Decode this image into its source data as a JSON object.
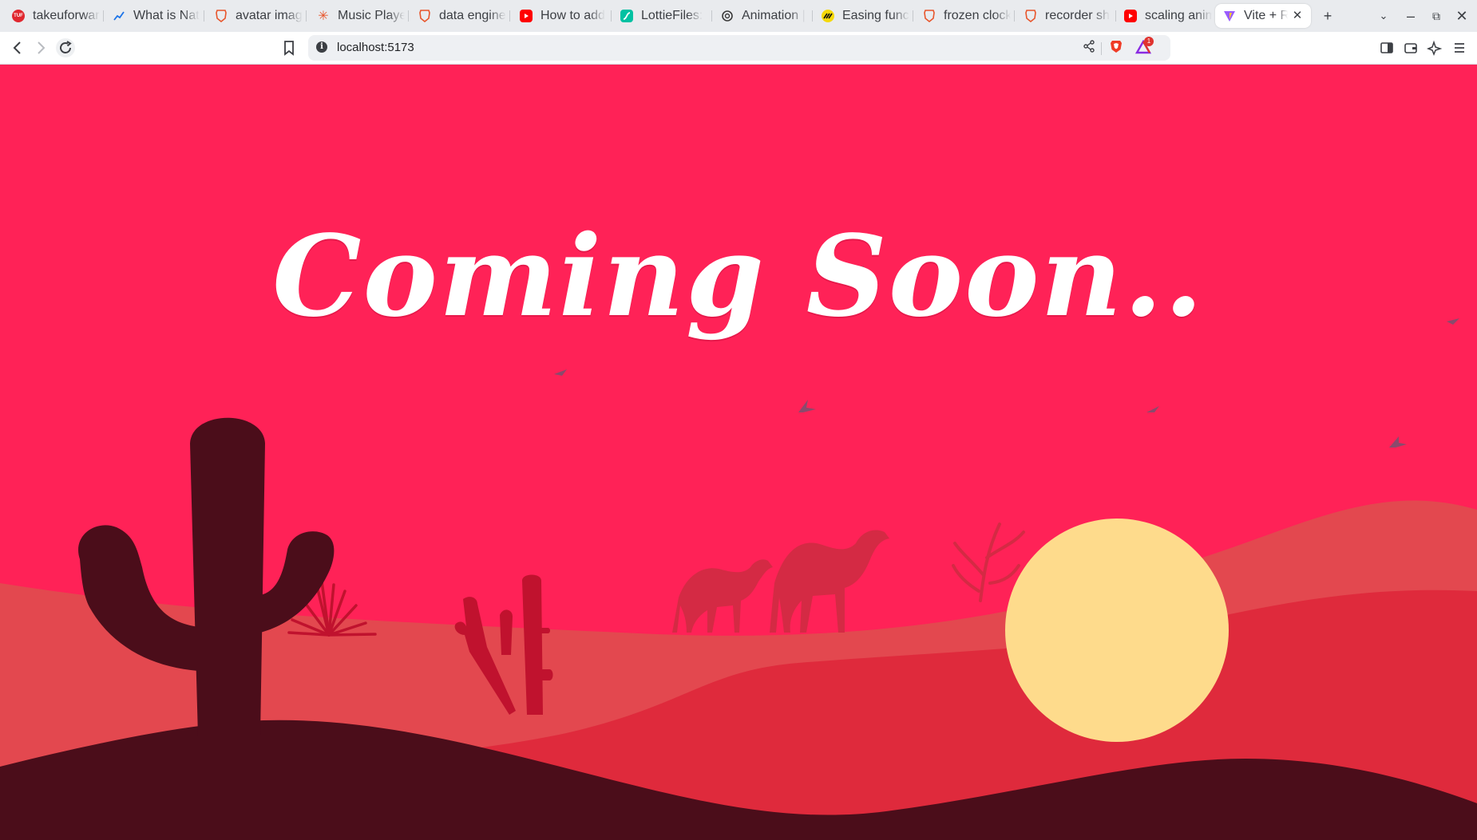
{
  "browser": {
    "tabs": [
      {
        "label": "takeuforward",
        "icon": "tuf-icon",
        "color": "#e0282f"
      },
      {
        "label": "What is Nat",
        "icon": "chart-trend-icon",
        "color": "#3a3a3a"
      },
      {
        "label": "avatar imag",
        "icon": "brave-shield-icon",
        "color": "#e8552b"
      },
      {
        "label": "Music Playe",
        "icon": "asterisk-icon",
        "color": "#e8552b"
      },
      {
        "label": "data engine",
        "icon": "brave-shield-icon",
        "color": "#e8552b"
      },
      {
        "label": "How to add",
        "icon": "youtube-icon",
        "color": "#ff0000"
      },
      {
        "label": "LottieFiles:",
        "icon": "lottie-icon",
        "color": "#00c1a2"
      },
      {
        "label": "Animation |",
        "icon": "openai-icon",
        "color": "#3a3a3a"
      },
      {
        "label": "Easing func",
        "icon": "easing-icon",
        "color": "#f5d90a"
      },
      {
        "label": "frozen clock",
        "icon": "brave-shield-icon",
        "color": "#e8552b"
      },
      {
        "label": "recorder sh",
        "icon": "brave-shield-icon",
        "color": "#e8552b"
      },
      {
        "label": "scaling anim",
        "icon": "youtube-icon",
        "color": "#ff0000"
      },
      {
        "label": "Vite + R",
        "icon": "vite-icon",
        "color": "#9a5cff",
        "active": true
      }
    ],
    "url": "localhost:5173",
    "rewards_badge": "1"
  },
  "page": {
    "headline": "Coming Soon..",
    "colors": {
      "sky": "#ff2257",
      "far_dune": "#e3484f",
      "mid_dune": "#df2a3c",
      "near_dune": "#4b0d1a",
      "sun": "#fedb8c",
      "cactus": "#c0122e",
      "camel": "#d42a44"
    }
  }
}
